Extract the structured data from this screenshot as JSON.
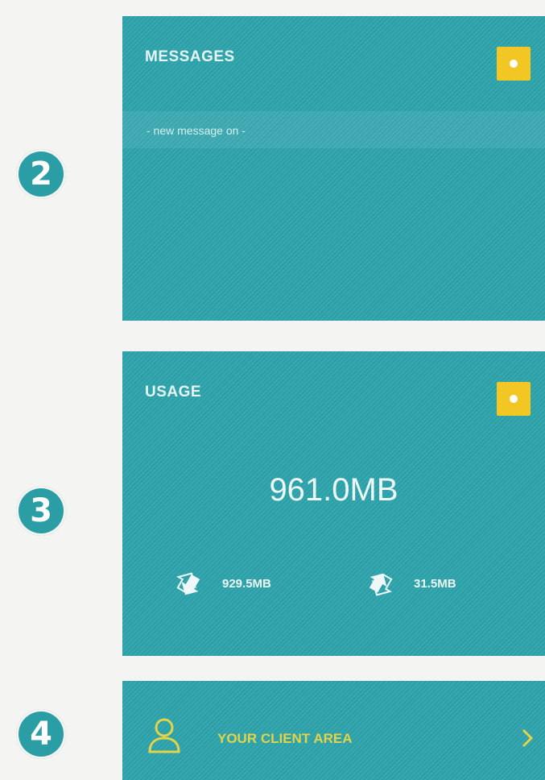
{
  "steps": {
    "messages": "2",
    "usage": "3",
    "client": "4"
  },
  "messages": {
    "title": "MESSAGES",
    "notice": "- new message on -",
    "icon": "settings-dot-icon"
  },
  "usage": {
    "title": "USAGE",
    "total": "961.0MB",
    "download": "929.5MB",
    "upload": "31.5MB",
    "icon": "settings-dot-icon"
  },
  "client_area": {
    "label": "YOUR CLIENT AREA",
    "icon": "user-icon"
  },
  "colors": {
    "card": "#2ca3ab",
    "button": "#f2c623",
    "marker": "#2a9ea4",
    "client_label": "#e2d34a"
  }
}
